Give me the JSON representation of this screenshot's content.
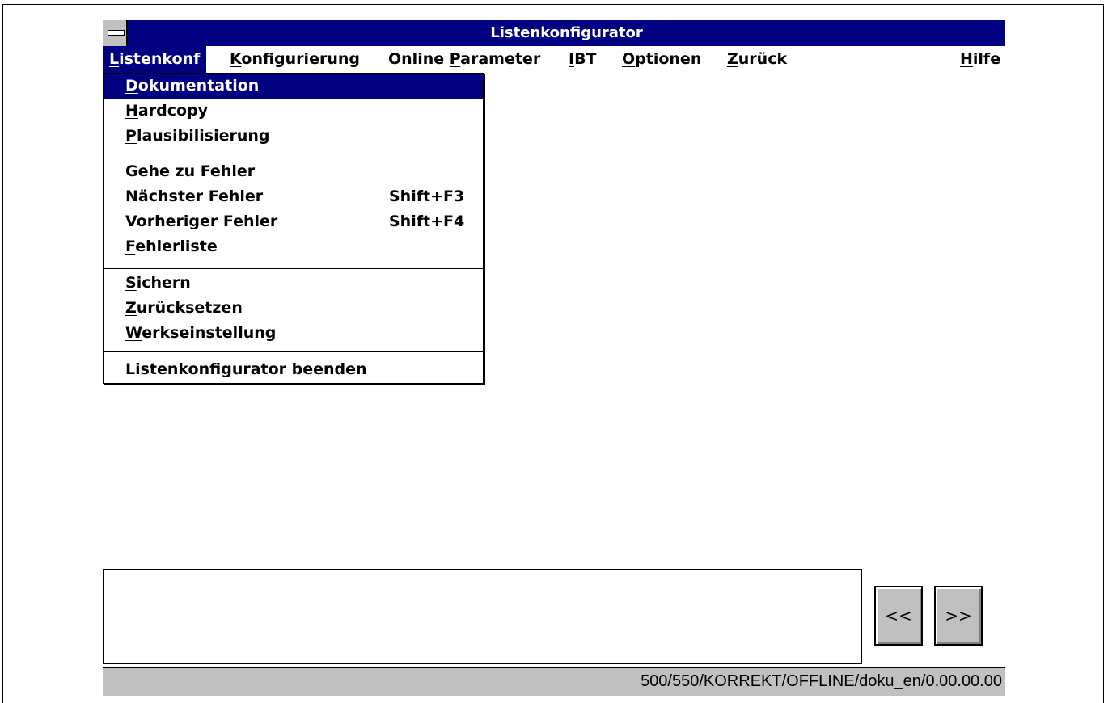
{
  "window": {
    "title": "Listenkonfigurator"
  },
  "menubar": {
    "items": [
      {
        "pre": "",
        "key": "L",
        "post": "istenkonf"
      },
      {
        "pre": "",
        "key": "K",
        "post": "onfigurierung"
      },
      {
        "pre": "Online ",
        "key": "P",
        "post": "arameter"
      },
      {
        "pre": "",
        "key": "I",
        "post": "BT"
      },
      {
        "pre": "",
        "key": "O",
        "post": "ptionen"
      },
      {
        "pre": "",
        "key": "Z",
        "post": "urück"
      },
      {
        "pre": "",
        "key": "H",
        "post": "ilfe"
      }
    ]
  },
  "dropdown": {
    "items": [
      {
        "key": "D",
        "rest": "okumentation",
        "shortcut": ""
      },
      {
        "key": "H",
        "rest": "ardcopy",
        "shortcut": ""
      },
      {
        "key": "P",
        "rest": "lausibilisierung",
        "shortcut": ""
      },
      {
        "key": "G",
        "rest": "ehe zu Fehler",
        "shortcut": ""
      },
      {
        "key": "N",
        "rest": "ächster Fehler",
        "shortcut": "Shift+F3"
      },
      {
        "key": "V",
        "rest": "orheriger Fehler",
        "shortcut": "Shift+F4"
      },
      {
        "key": "F",
        "rest": "ehlerliste",
        "shortcut": ""
      },
      {
        "key": "S",
        "rest": "ichern",
        "shortcut": ""
      },
      {
        "key": "Z",
        "rest": "urücksetzen",
        "shortcut": ""
      },
      {
        "key": "W",
        "rest": "erkseinstellung",
        "shortcut": ""
      },
      {
        "key": "L",
        "rest": "istenkonfigurator beenden",
        "shortcut": ""
      }
    ]
  },
  "nav": {
    "prev_label": "<<",
    "next_label": ">>"
  },
  "statusbar": {
    "text": "500/550/KORREKT/OFFLINE/doku_en/0.00.00.00"
  },
  "colors": {
    "titlebar": "#000080",
    "selection": "#000080",
    "face": "#c0c0c0"
  },
  "icons": {
    "system_menu": "system-menu-icon"
  }
}
